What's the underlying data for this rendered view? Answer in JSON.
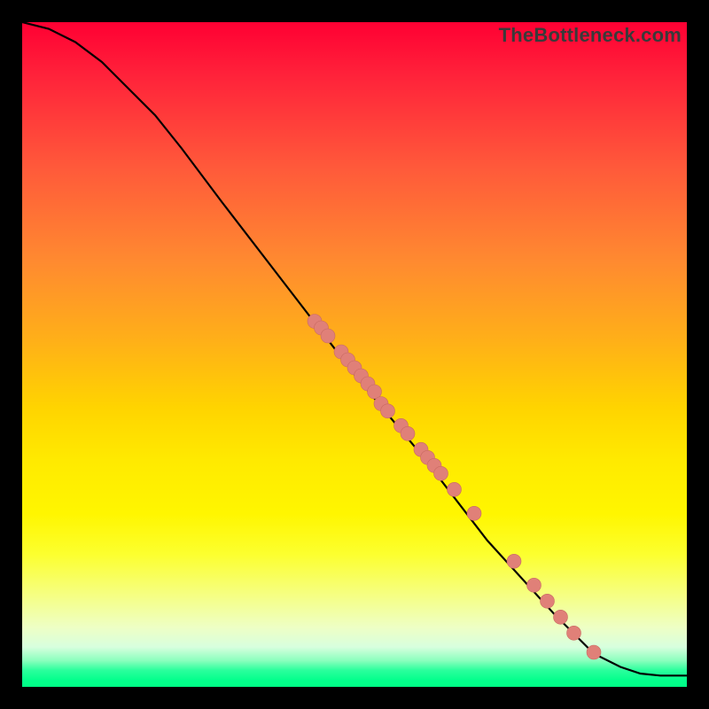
{
  "watermark": "TheBottleneck.com",
  "chart_data": {
    "type": "line",
    "title": "",
    "xlabel": "",
    "ylabel": "",
    "xlim": [
      0,
      100
    ],
    "ylim": [
      0,
      100
    ],
    "grid": false,
    "series": [
      {
        "name": "curve",
        "x": [
          0,
          4,
          8,
          12,
          16,
          20,
          24,
          30,
          40,
          50,
          60,
          70,
          80,
          86,
          90,
          93,
          96,
          100
        ],
        "y": [
          100,
          99,
          97,
          94,
          90,
          86,
          81,
          73,
          60,
          47,
          35,
          22,
          11,
          5,
          3,
          2,
          1.7,
          1.7
        ]
      }
    ],
    "points": {
      "name": "samples",
      "x": [
        44,
        45,
        46,
        48,
        49,
        50,
        51,
        52,
        53,
        54,
        55,
        57,
        58,
        60,
        61,
        62,
        63,
        65,
        68,
        74,
        77,
        79,
        81,
        83,
        86
      ],
      "y": [
        55,
        54,
        52.8,
        50.4,
        49.2,
        48,
        46.8,
        45.6,
        44.4,
        42.6,
        41.5,
        39.3,
        38.1,
        35.7,
        34.5,
        33.3,
        32.1,
        29.7,
        26.1,
        18.9,
        15.3,
        12.9,
        10.5,
        8.1,
        5.2
      ]
    }
  }
}
